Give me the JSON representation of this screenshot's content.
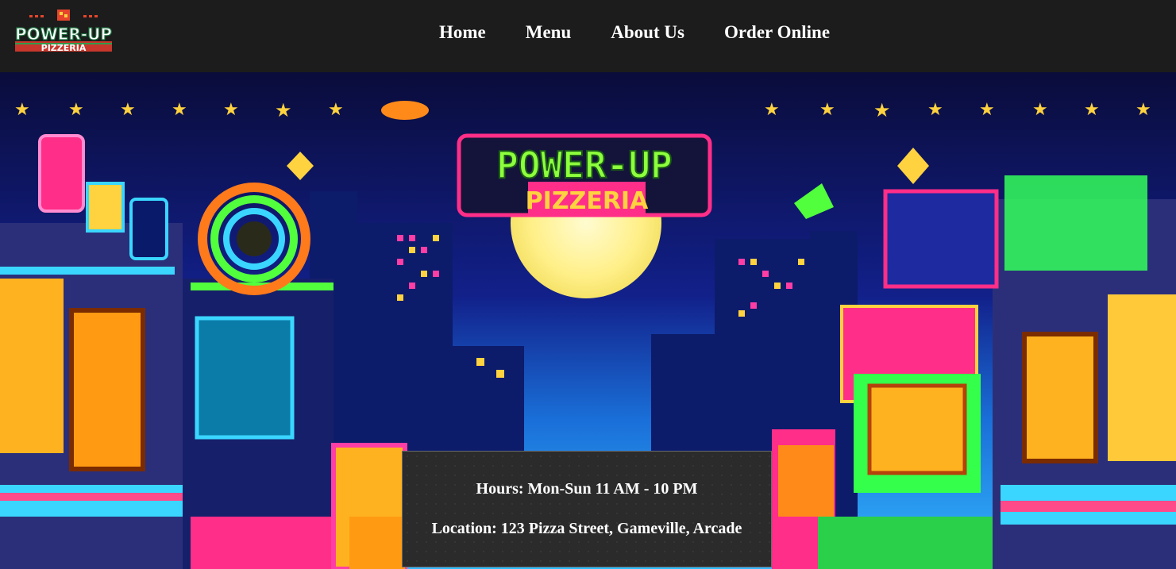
{
  "header": {
    "logo": {
      "name": "POWER-UP",
      "sub": "PIZZERIA"
    },
    "nav": [
      {
        "label": "Home"
      },
      {
        "label": "Menu"
      },
      {
        "label": "About Us"
      },
      {
        "label": "Order Online"
      }
    ]
  },
  "hero": {
    "sign": {
      "title": "POWER-UP",
      "subtitle": "PIZZERIA"
    },
    "info": {
      "hours": "Hours: Mon-Sun 11 AM - 10 PM",
      "location": "Location: 123 Pizza Street, Gameville, Arcade"
    }
  },
  "colors": {
    "header_bg": "#1c1c1c",
    "nav_text": "#ffffff",
    "info_bg": "#2b2b2b",
    "neon_green": "#7CFC3C",
    "neon_pink": "#ff2e88",
    "neon_yellow": "#ffd23f"
  }
}
